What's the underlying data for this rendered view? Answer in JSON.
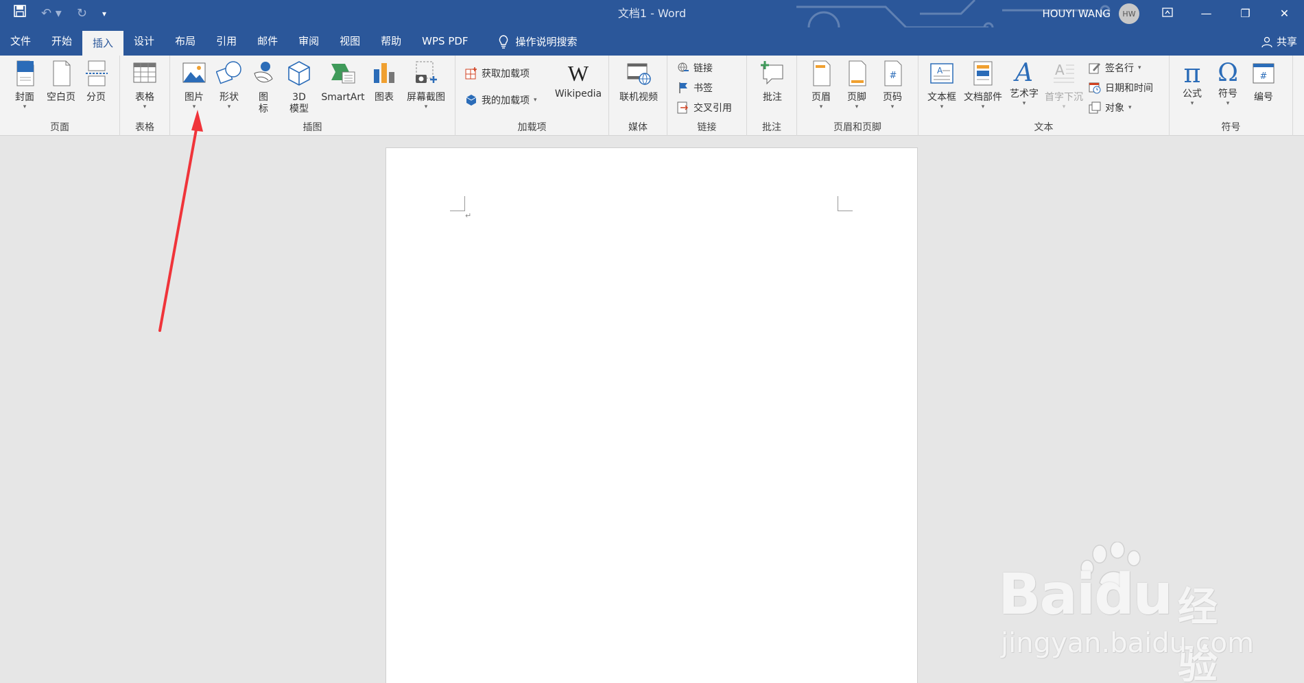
{
  "window": {
    "title": "文档1  -  Word",
    "user_name": "HOUYI WANG",
    "user_initials": "HW"
  },
  "tabs": [
    {
      "label": "文件"
    },
    {
      "label": "开始"
    },
    {
      "label": "插入"
    },
    {
      "label": "设计"
    },
    {
      "label": "布局"
    },
    {
      "label": "引用"
    },
    {
      "label": "邮件"
    },
    {
      "label": "审阅"
    },
    {
      "label": "视图"
    },
    {
      "label": "帮助"
    },
    {
      "label": "WPS PDF"
    }
  ],
  "active_tab": "插入",
  "tell_me": "操作说明搜索",
  "share": "共享",
  "ribbon": {
    "pages": {
      "label": "页面",
      "cover": "封面",
      "blank": "空白页",
      "break": "分页"
    },
    "tables": {
      "label": "表格",
      "table": "表格"
    },
    "illustrations": {
      "label": "插图",
      "pictures": "图片",
      "shapes": "形状",
      "icons_line1": "图",
      "icons_line2": "标",
      "model_line1": "3D",
      "model_line2": "模型",
      "smartart": "SmartArt",
      "chart": "图表",
      "screenshot": "屏幕截图"
    },
    "addins": {
      "label": "加载项",
      "get": "获取加载项",
      "my": "我的加载项",
      "wikipedia": "Wikipedia"
    },
    "media": {
      "label": "媒体",
      "video": "联机视频"
    },
    "links": {
      "label": "链接",
      "link": "链接",
      "bookmark": "书签",
      "crossref": "交叉引用"
    },
    "comments": {
      "label": "批注",
      "comment": "批注"
    },
    "header_footer": {
      "label": "页眉和页脚",
      "header": "页眉",
      "footer": "页脚",
      "page_number": "页码"
    },
    "text": {
      "label": "文本",
      "textbox": "文本框",
      "quickparts": "文档部件",
      "wordart": "艺术字",
      "dropcap": "首字下沉",
      "signature": "签名行",
      "datetime": "日期和时间",
      "object": "对象"
    },
    "symbols": {
      "label": "符号",
      "equation": "公式",
      "symbol": "符号",
      "number": "编号"
    }
  },
  "document": {
    "paragraph_mark": "↵"
  },
  "watermark": {
    "brand": "Bai",
    "brand2": "du",
    "cn": "经验",
    "sub": "jingyan.baidu.com"
  },
  "colors": {
    "title_bar": "#2b579a",
    "ribbon": "#f3f3f3",
    "workspace": "#e6e6e6",
    "arrow": "#f0343a"
  }
}
